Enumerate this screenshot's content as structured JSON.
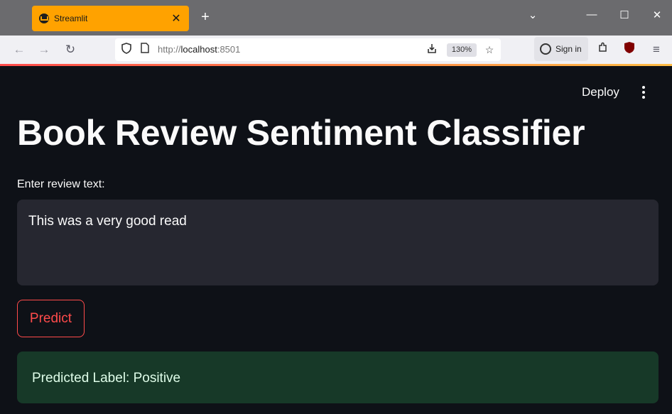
{
  "browser": {
    "tab_title": "Streamlit",
    "tab_close": "✕",
    "new_tab": "+",
    "controls": {
      "dropdown": "⌄",
      "minimize": "—",
      "maximize": "☐",
      "close": "✕"
    },
    "nav": {
      "back": "←",
      "forward": "→",
      "reload": "↻"
    },
    "url_prefix": "http://",
    "url_host": "localhost",
    "url_port": ":8501",
    "zoom": "130%",
    "sign_in": "Sign in",
    "accent_colors": [
      "#ff4b4b",
      "#ffbd45"
    ]
  },
  "app": {
    "deploy_label": "Deploy",
    "title": "Book Review Sentiment Classifier",
    "input_label": "Enter review text:",
    "input_value": "This was a very good read",
    "button_label": "Predict",
    "result_text": "Predicted Label: Positive"
  },
  "colors": {
    "background": "#0e1117",
    "input_bg": "#262730",
    "primary": "#ff4b4b",
    "success_bg": "#173928",
    "success_text": "#dffde9",
    "tab_active": "#ffa200"
  }
}
